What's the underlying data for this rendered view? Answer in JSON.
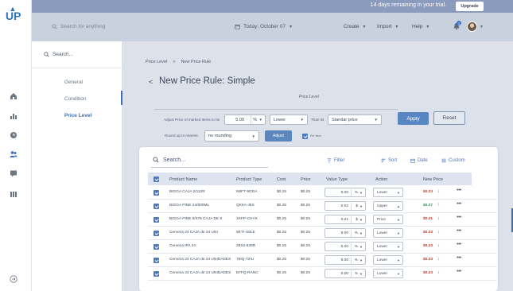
{
  "trial": {
    "text": "14 days remaining in your trial.",
    "upgrade_label": "Upgrade"
  },
  "header": {
    "search_placeholder": "Search for anything",
    "date_label": "Today: October 07",
    "menus": [
      "Create",
      "Import",
      "Help"
    ],
    "notification_count": "1"
  },
  "subnav": {
    "search_label": "Search...",
    "items": [
      {
        "label": "General"
      },
      {
        "label": "Condition"
      },
      {
        "label": "Price Level"
      }
    ]
  },
  "page": {
    "breadcrumb": [
      "Price Level",
      "New Price Rule"
    ],
    "breadcrumb_sep": ">",
    "back_glyph": "<",
    "title": "New Price Rule: Simple",
    "section_label": "Price Level"
  },
  "form": {
    "adjust_label": "Adjust Price of marked Items to be",
    "amount_value": "5.00",
    "amount_unit": "%",
    "direction_value": "Lower",
    "then_label": "Than its",
    "base_value": "Standar price",
    "round_label": "Round up to nearest",
    "round_value": "no rounding",
    "adjust_button": "Adjust",
    "per_item_label": "Per Item",
    "apply_button": "Apply",
    "reset_button": "Reset"
  },
  "toolbar": {
    "search_label": "Search...",
    "filter": "Filter",
    "sort": "Sort",
    "date": "Date",
    "custom": "Custom"
  },
  "table": {
    "columns": {
      "name": "Product Name",
      "type": "Product Type",
      "cost": "Cost",
      "price": "Price",
      "value_type": "Value Type",
      "action": "Action",
      "new_price": "New Price"
    },
    "rows": [
      {
        "name": "BIGGA CAJA 2/112R",
        "type": "N9FT-9GDA",
        "cost": "$0.25",
        "price": "$0.25",
        "value": "5.00",
        "unit": "%",
        "action": "Lower",
        "new_price": "$0.23",
        "dir": "down"
      },
      {
        "name": "BIGGA PINE 24/600ML",
        "type": "QK6A-J6S",
        "cost": "$0.25",
        "price": "$0.25",
        "value": "0.02",
        "unit": "$",
        "action": "Upper",
        "new_price": "$0.27",
        "dir": "up"
      },
      {
        "name": "BIGGA PINE 8/378 CAJA DE 8",
        "type": "3XFP-CHYK",
        "cost": "$0.25",
        "price": "$0.25",
        "value": "0.21",
        "unit": "$",
        "action": "Price",
        "new_price": "$0.21",
        "dir": "down"
      },
      {
        "name": "Cerveza 24 CAJA de 24 UNI",
        "type": "6ETI-U8LE",
        "cost": "$0.25",
        "price": "$0.25",
        "value": "5.00",
        "unit": "%",
        "action": "Lower",
        "new_price": "$0.23",
        "dir": "down"
      },
      {
        "name": "Cerveza IPA 24",
        "type": "28S2-835R",
        "cost": "$0.25",
        "price": "$0.25",
        "value": "5.00",
        "unit": "%",
        "action": "Lower",
        "new_price": "$0.23",
        "dir": "down"
      },
      {
        "name": "Cerveza 24 CAJA de 24 UNIDADES",
        "type": "76IQ-72IU",
        "cost": "$0.25",
        "price": "$0.25",
        "value": "5.00",
        "unit": "%",
        "action": "Lower",
        "new_price": "$0.23",
        "dir": "down"
      },
      {
        "name": "Cerveza 24 CAJA de 24 UNIDADES",
        "type": "B7FQ-RANC",
        "cost": "$0.25",
        "price": "$0.25",
        "value": "5.00",
        "unit": "%",
        "action": "Lower",
        "new_price": "$0.23",
        "dir": "down"
      }
    ]
  },
  "colors": {
    "accent": "#3f6fb1",
    "price_down": "#c0392b",
    "price_up": "#2f8f53"
  }
}
